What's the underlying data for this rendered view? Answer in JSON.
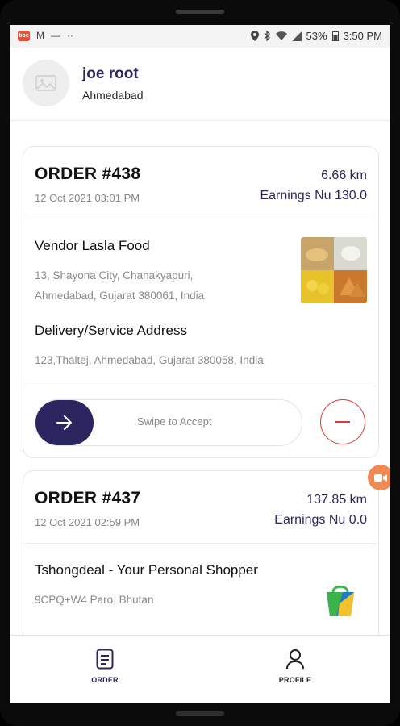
{
  "status_bar": {
    "app_badge": "bbc",
    "battery": "53%",
    "time": "3:50 PM"
  },
  "profile": {
    "name": "joe root",
    "city": "Ahmedabad"
  },
  "orders": [
    {
      "title": "ORDER #438",
      "date": "12 Oct 2021 03:01 PM",
      "distance": "6.66 km",
      "earnings": "Earnings Nu 130.0",
      "vendor": "Vendor Lasla Food",
      "vendor_address_line1": "13, Shayona City, Chanakyapuri,",
      "vendor_address_line2": "Ahmedabad, Gujarat 380061, India",
      "delivery_heading": "Delivery/Service Address",
      "delivery_address": "123,Thaltej, Ahmedabad, Gujarat 380058, India",
      "swipe_label": "Swipe to Accept"
    },
    {
      "title": "ORDER #437",
      "date": "12 Oct 2021 02:59 PM",
      "distance": "137.85 km",
      "earnings": "Earnings Nu 0.0",
      "vendor": "Tshongdeal - Your Personal Shopper",
      "vendor_address_line1": "9CPQ+W4 Paro, Bhutan"
    }
  ],
  "nav": {
    "order_label": "ORDER",
    "profile_label": "PROFILE"
  },
  "colors": {
    "accent": "#2c2660",
    "reject": "#e03a3a",
    "floating_button": "#f08a55"
  }
}
